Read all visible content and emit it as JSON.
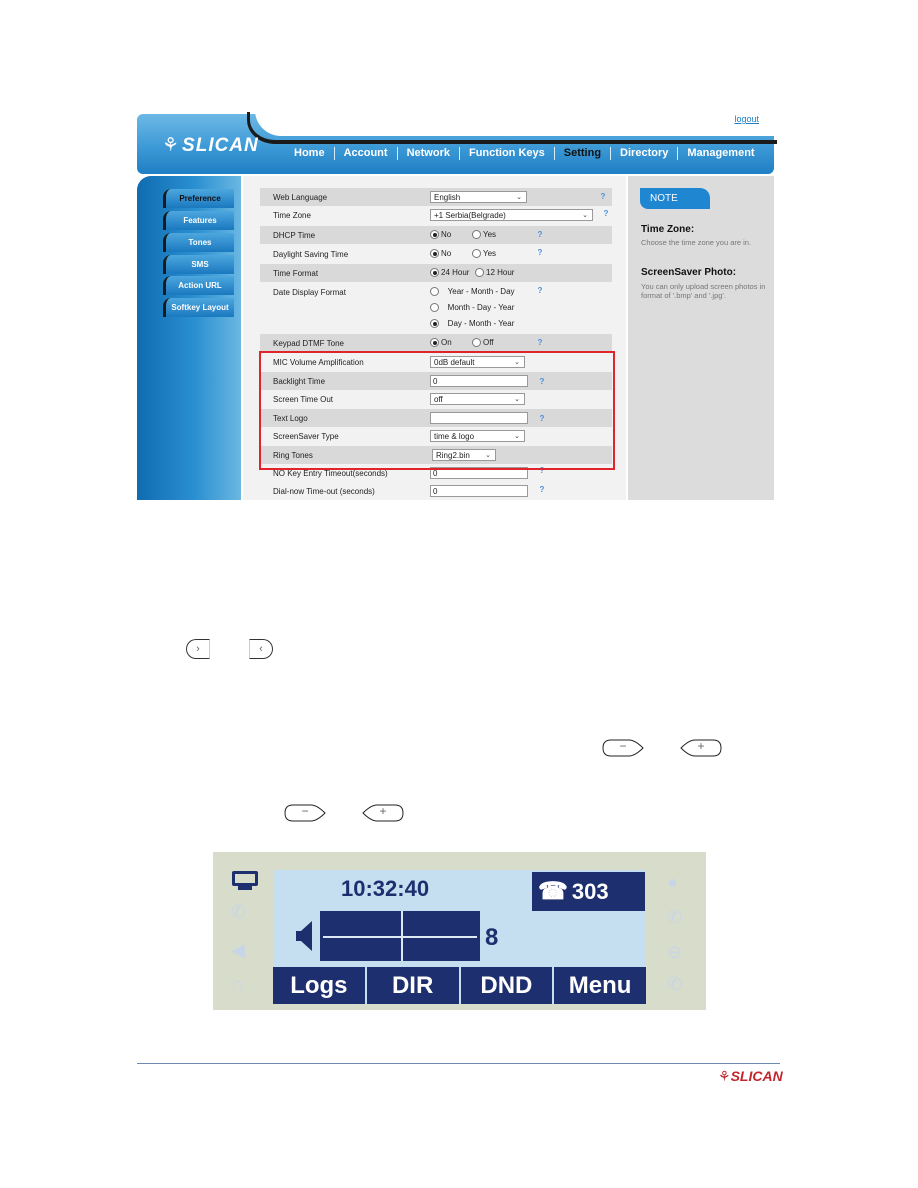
{
  "webui": {
    "logo": "SLICAN",
    "logout": "logout",
    "nav": [
      "Home",
      "Account",
      "Network",
      "Function Keys",
      "Setting",
      "Directory",
      "Management"
    ],
    "nav_active": "Setting",
    "sidebar": [
      "Preference",
      "Features",
      "Tones",
      "SMS",
      "Action URL",
      "Softkey Layout"
    ],
    "sidebar_active": "Preference",
    "settings": {
      "web_language": {
        "label": "Web Language",
        "value": "English"
      },
      "time_zone": {
        "label": "Time Zone",
        "value": "+1 Serbia(Belgrade)"
      },
      "dhcp_time": {
        "label": "DHCP Time",
        "options": [
          "No",
          "Yes"
        ],
        "selected": "No"
      },
      "dst": {
        "label": "Daylight Saving Time",
        "options": [
          "No",
          "Yes"
        ],
        "selected": "No"
      },
      "time_format": {
        "label": "Time Format",
        "options": [
          "24 Hour",
          "12 Hour"
        ],
        "selected": "24 Hour"
      },
      "date_format": {
        "label": "Date Display Format",
        "options": [
          "Year - Month - Day",
          "Month - Day - Year",
          "Day - Month - Year"
        ],
        "selected": "Day - Month - Year"
      },
      "dtmf_tone": {
        "label": "Keypad DTMF Tone",
        "options": [
          "On",
          "Off"
        ],
        "selected": "On"
      },
      "mic_volume": {
        "label": "MIC Volume Amplification",
        "value": "0dB default"
      },
      "backlight": {
        "label": "Backlight Time",
        "value": "0"
      },
      "screen_timeout": {
        "label": "Screen Time Out",
        "value": "off"
      },
      "text_logo": {
        "label": "Text Logo",
        "value": ""
      },
      "screensaver_type": {
        "label": "ScreenSaver Type",
        "value": "time & logo"
      },
      "ring_tones": {
        "label": "Ring Tones",
        "value": "Ring2.bin"
      },
      "no_key_timeout": {
        "label": "NO Key Entry Timeout(seconds)",
        "value": "0"
      },
      "dial_now_timeout": {
        "label": "Dial-now Time-out (seconds)",
        "value": "0"
      }
    },
    "help_glyph": "?",
    "chevron_glyph": "⌄",
    "note": {
      "tag": "NOTE",
      "items": [
        {
          "title": "Time Zone:",
          "text": "Choose the time zone you are in."
        },
        {
          "title": "ScreenSaver Photo:",
          "text": "You can only upload screen photos in format of '.bmp' and '.jpg'."
        }
      ]
    }
  },
  "keys": {
    "right": "›",
    "left": "‹",
    "minus": "−",
    "plus": "+"
  },
  "lcd": {
    "time": "10:32:40",
    "line_number": "303",
    "phone_glyph": "☎",
    "volume_level": "8",
    "softkeys": [
      "Logs",
      "DIR",
      "DND",
      "Menu"
    ]
  },
  "footer": {
    "logo": "SLICAN",
    "tree_glyph": "⚘"
  }
}
